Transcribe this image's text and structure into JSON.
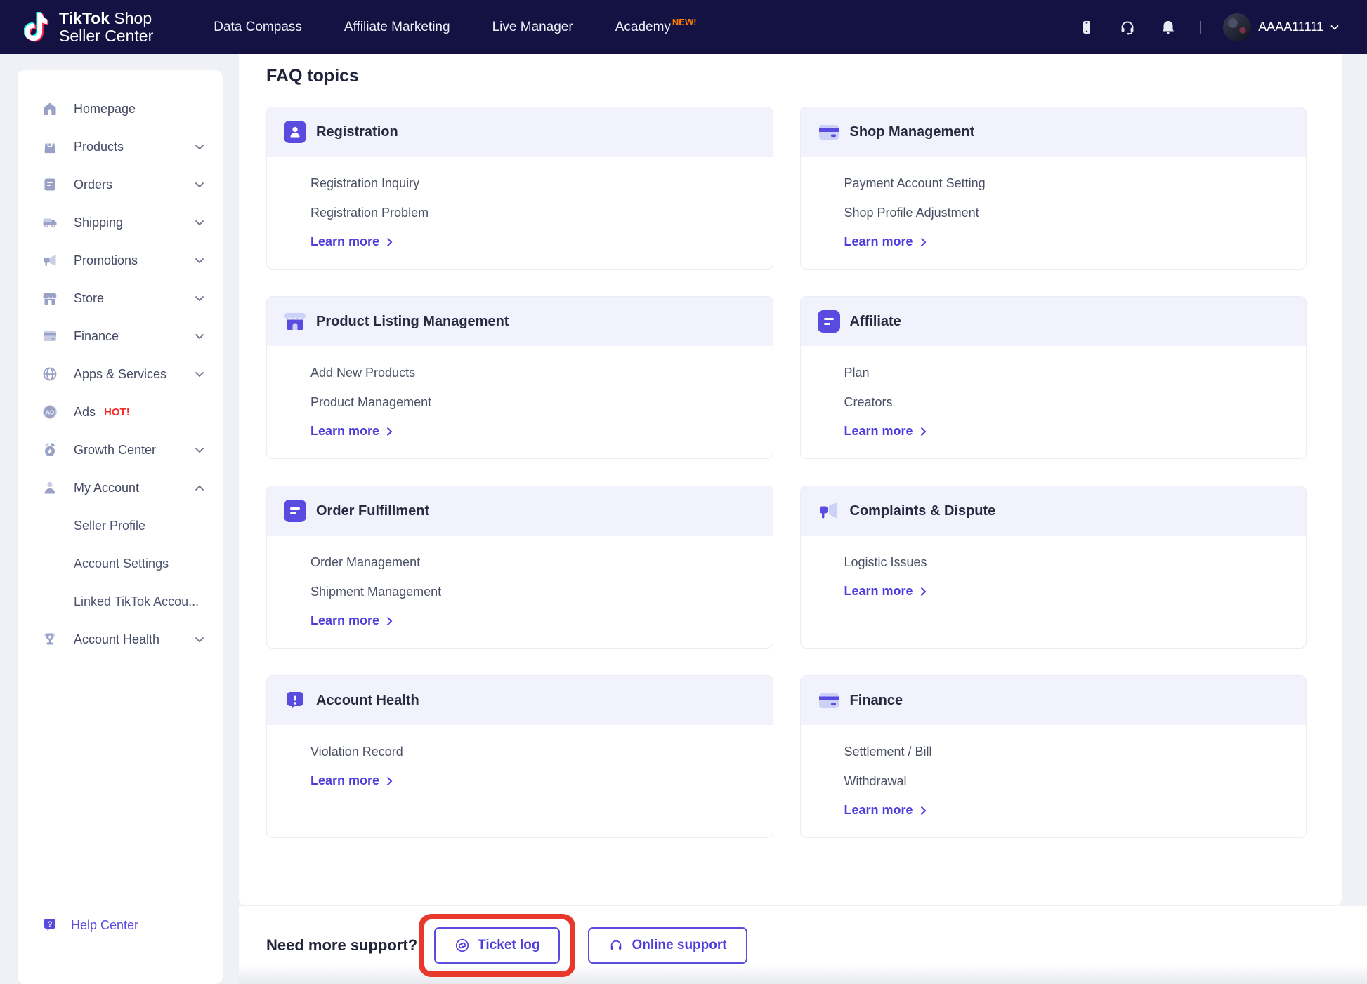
{
  "navbar": {
    "logo": {
      "brand_bold": "TikTok",
      "brand_regular": "Shop",
      "line2": "Seller Center"
    },
    "items": [
      {
        "label": "Data Compass"
      },
      {
        "label": "Affiliate Marketing"
      },
      {
        "label": "Live Manager"
      },
      {
        "label": "Academy",
        "badge": "NEW!"
      }
    ],
    "user": {
      "name": "AAAA11111"
    }
  },
  "sidebar": {
    "items": [
      {
        "label": "Homepage",
        "icon": "home"
      },
      {
        "label": "Products",
        "icon": "bag",
        "chevron": "down"
      },
      {
        "label": "Orders",
        "icon": "doc-gray",
        "chevron": "down"
      },
      {
        "label": "Shipping",
        "icon": "truck",
        "chevron": "down"
      },
      {
        "label": "Promotions",
        "icon": "megaphone-gray",
        "chevron": "down"
      },
      {
        "label": "Store",
        "icon": "store-gray",
        "chevron": "down"
      },
      {
        "label": "Finance",
        "icon": "card-gray",
        "chevron": "down"
      },
      {
        "label": "Apps & Services",
        "icon": "globe",
        "chevron": "down"
      },
      {
        "label": "Ads",
        "icon": "ad",
        "badge": "HOT!"
      },
      {
        "label": "Growth Center",
        "icon": "medal",
        "chevron": "down"
      },
      {
        "label": "My Account",
        "icon": "person-gray",
        "chevron": "up",
        "children": [
          "Seller Profile",
          "Account Settings",
          "Linked TikTok Accou..."
        ]
      },
      {
        "label": "Account Health",
        "icon": "trophy",
        "chevron": "down"
      }
    ],
    "help": {
      "label": "Help Center"
    }
  },
  "main": {
    "heading": "FAQ topics",
    "cards": [
      {
        "title": "Registration",
        "icon": "person-badge",
        "items": [
          "Registration Inquiry",
          "Registration Problem"
        ],
        "learn_more": "Learn more"
      },
      {
        "title": "Shop Management",
        "icon": "credit-card",
        "items": [
          "Payment Account Setting",
          "Shop Profile Adjustment"
        ],
        "learn_more": "Learn more"
      },
      {
        "title": "Product Listing Management",
        "icon": "storefront",
        "items": [
          "Add New Products",
          "Product Management"
        ],
        "learn_more": "Learn more"
      },
      {
        "title": "Affiliate",
        "icon": "doc-purple",
        "items": [
          "Plan",
          "Creators"
        ],
        "learn_more": "Learn more"
      },
      {
        "title": "Order Fulfillment",
        "icon": "doc-purple",
        "items": [
          "Order Management",
          "Shipment Management"
        ],
        "learn_more": "Learn more"
      },
      {
        "title": "Complaints & Dispute",
        "icon": "megaphone-purple",
        "items": [
          "Logistic Issues"
        ],
        "learn_more": "Learn more"
      },
      {
        "title": "Account Health",
        "icon": "alert-bubble",
        "items": [
          "Violation Record"
        ],
        "learn_more": "Learn more"
      },
      {
        "title": "Finance",
        "icon": "credit-card",
        "items": [
          "Settlement / Bill",
          "Withdrawal"
        ],
        "learn_more": "Learn more"
      }
    ]
  },
  "support": {
    "prompt": "Need more support?",
    "ticket_button": "Ticket log",
    "online_button": "Online support"
  },
  "colors": {
    "navbar_bg": "#131242",
    "accent_purple": "#5a4be0",
    "link_purple": "#4e3cdb",
    "light_purple": "#ccd1f7",
    "card_header_bg": "#f1f2fc",
    "new_badge": "#ff7d00",
    "hot_badge": "#f22c2c",
    "annotation_red": "#e8382b"
  }
}
